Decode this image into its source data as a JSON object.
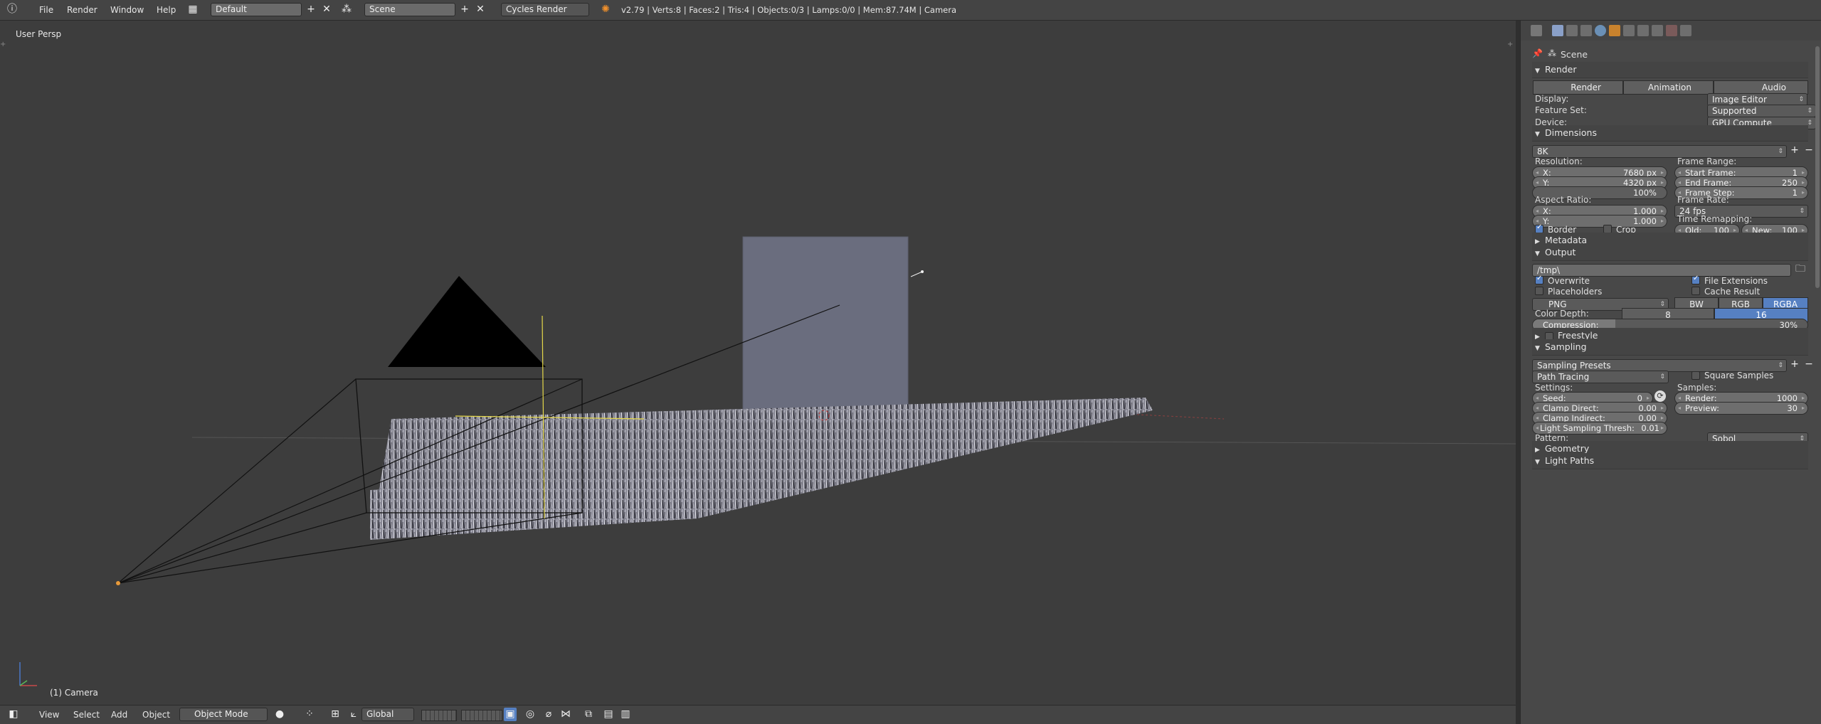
{
  "topbar": {
    "menu": [
      "File",
      "Render",
      "Window",
      "Help"
    ],
    "layout_name": "Default",
    "scene_name": "Scene",
    "engine": "Cycles Render",
    "stats": "v2.79 | Verts:8 | Faces:2 | Tris:4 | Objects:0/3 | Lamps:0/0 | Mem:87.74M | Camera"
  },
  "viewport": {
    "view_label": "User Persp",
    "object_label": "(1) Camera"
  },
  "bottombar": {
    "menu": [
      "View",
      "Select",
      "Add",
      "Object"
    ],
    "mode": "Object Mode",
    "orientation": "Global"
  },
  "props": {
    "context_label": "Scene",
    "render": {
      "title": "Render",
      "buttons": [
        "Render",
        "Animation",
        "Audio"
      ],
      "display_label": "Display:",
      "display_value": "Image Editor",
      "feature_label": "Feature Set:",
      "feature_value": "Supported",
      "device_label": "Device:",
      "device_value": "GPU Compute"
    },
    "dimensions": {
      "title": "Dimensions",
      "preset": "8K",
      "resolution_label": "Resolution:",
      "res_x_label": "X:",
      "res_x": "7680 px",
      "res_y_label": "Y:",
      "res_y": "4320 px",
      "res_pct": "100%",
      "frame_range_label": "Frame Range:",
      "start_label": "Start Frame:",
      "start": "1",
      "end_label": "End Frame:",
      "end": "250",
      "step_label": "Frame Step:",
      "step": "1",
      "aspect_label": "Aspect Ratio:",
      "asp_x_label": "X:",
      "asp_x": "1.000",
      "asp_y_label": "Y:",
      "asp_y": "1.000",
      "frame_rate_label": "Frame Rate:",
      "frame_rate": "24 fps",
      "time_remap_label": "Time Remapping:",
      "old_label": "Old:",
      "old": "100",
      "new_label": "New:",
      "new": "100",
      "border_label": "Border",
      "crop_label": "Crop"
    },
    "metadata": {
      "title": "Metadata"
    },
    "output": {
      "title": "Output",
      "path": "/tmp\\",
      "overwrite": "Overwrite",
      "file_ext": "File Extensions",
      "placeholders": "Placeholders",
      "cache_result": "Cache Result",
      "format": "PNG",
      "color_modes": [
        "BW",
        "RGB",
        "RGBA"
      ],
      "depth_label": "Color Depth:",
      "depths": [
        "8",
        "16"
      ],
      "compression_label": "Compression:",
      "compression": "30%",
      "compression_level": 0.3
    },
    "freestyle": {
      "title": "Freestyle"
    },
    "sampling": {
      "title": "Sampling",
      "presets": "Sampling Presets",
      "integrator": "Path Tracing",
      "square_samples": "Square Samples",
      "settings_label": "Settings:",
      "samples_label": "Samples:",
      "seed_label": "Seed:",
      "seed": "0",
      "clamp_direct_label": "Clamp Direct:",
      "clamp_direct": "0.00",
      "clamp_indirect_label": "Clamp Indirect:",
      "clamp_indirect": "0.00",
      "light_thresh_label": "Light Sampling Thresh:",
      "light_thresh": "0.01",
      "render_label": "Render:",
      "render": "1000",
      "preview_label": "Preview:",
      "preview": "30",
      "pattern_label": "Pattern:",
      "pattern": "Sobol"
    },
    "geometry": {
      "title": "Geometry"
    },
    "light_paths": {
      "title": "Light Paths"
    }
  },
  "colors": {
    "accent": "#5680c2",
    "panel": "#484848",
    "viewport": "#3d3d3d"
  }
}
